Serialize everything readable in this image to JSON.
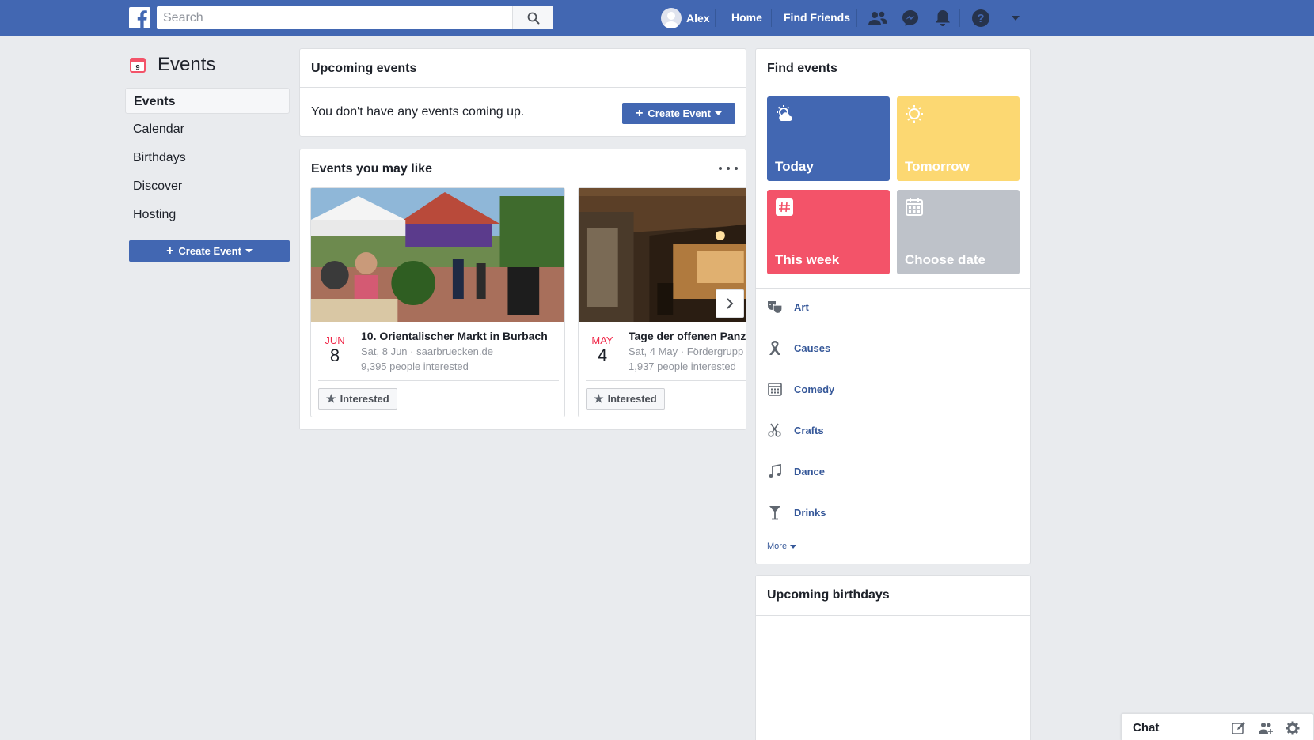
{
  "topbar": {
    "search_placeholder": "Search",
    "user_name": "Alex",
    "nav_home": "Home",
    "nav_find_friends": "Find Friends",
    "icons": [
      "friend-requests-icon",
      "messenger-icon",
      "notifications-icon",
      "help-icon",
      "account-menu-icon"
    ]
  },
  "left": {
    "title": "Events",
    "calendar_icon_day": "9",
    "nav": [
      {
        "label": "Events",
        "active": true
      },
      {
        "label": "Calendar",
        "active": false
      },
      {
        "label": "Birthdays",
        "active": false
      },
      {
        "label": "Discover",
        "active": false
      },
      {
        "label": "Hosting",
        "active": false
      }
    ],
    "create_button": "Create Event"
  },
  "upcoming": {
    "title": "Upcoming events",
    "empty_text": "You don't have any events coming up.",
    "create_button": "Create Event"
  },
  "may_like": {
    "title": "Events you may like",
    "events": [
      {
        "month": "JUN",
        "day": "8",
        "name": "10. Orientalischer Markt in Burbach",
        "meta": "Sat, 8 Jun · saarbruecken.de",
        "people": "9,395 people interested",
        "button": "Interested"
      },
      {
        "month": "MAY",
        "day": "4",
        "name": "Tage der offenen Panzer",
        "meta": "Sat, 4 May · Fördergrupp",
        "people": "1,937 people interested",
        "button": "Interested"
      }
    ]
  },
  "find_events": {
    "title": "Find events",
    "tiles": [
      {
        "label": "Today",
        "color": "#4267b2"
      },
      {
        "label": "Tomorrow",
        "color": "#fcd872"
      },
      {
        "label": "This week",
        "color": "#f35369"
      },
      {
        "label": "Choose date",
        "color": "#bec2c9"
      }
    ],
    "categories": [
      {
        "label": "Art",
        "icon": "art-masks-icon"
      },
      {
        "label": "Causes",
        "icon": "ribbon-icon"
      },
      {
        "label": "Comedy",
        "icon": "calendar-grid-icon"
      },
      {
        "label": "Crafts",
        "icon": "scissors-icon"
      },
      {
        "label": "Dance",
        "icon": "music-note-icon"
      },
      {
        "label": "Drinks",
        "icon": "cocktail-icon"
      }
    ],
    "more": "More"
  },
  "birthdays": {
    "title": "Upcoming birthdays"
  },
  "chat": {
    "label": "Chat"
  },
  "colors": {
    "brand": "#4267b2",
    "link": "#365899",
    "date_red": "#f02849",
    "background": "#e9ebee"
  }
}
